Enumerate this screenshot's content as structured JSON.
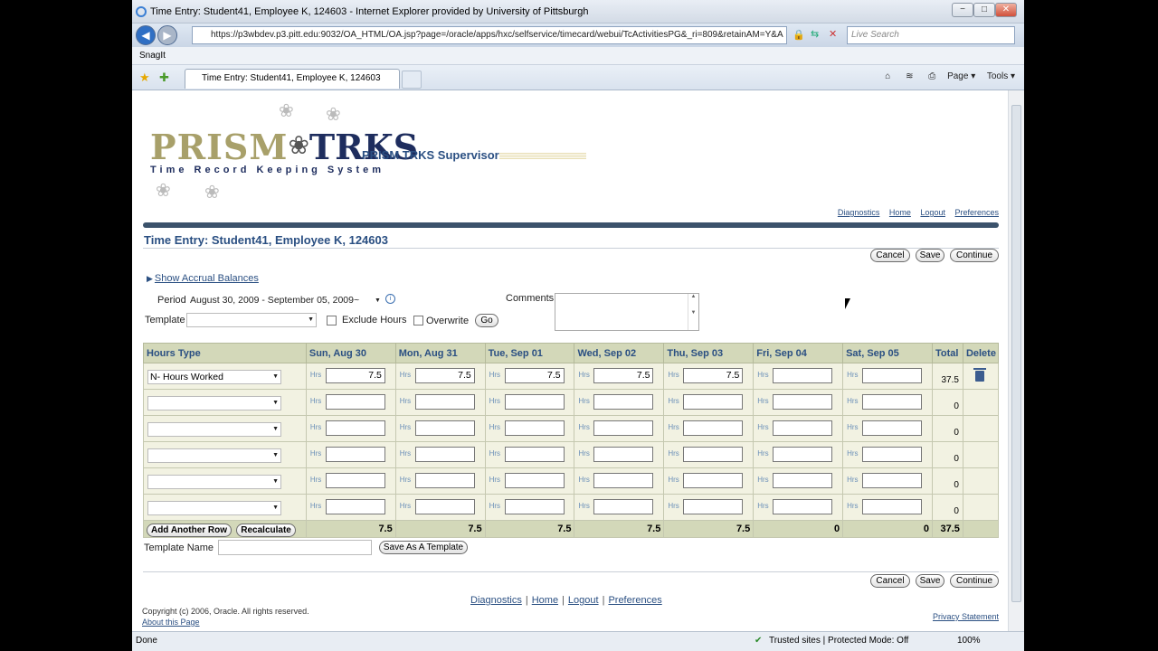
{
  "window": {
    "title": "Time Entry: Student41, Employee K, 124603 - Internet Explorer provided by University of Pittsburgh",
    "minimize": "−",
    "maximize": "□",
    "close": "✕"
  },
  "browser": {
    "url": "https://p3wbdev.p3.pitt.edu:9032/OA_HTML/OA.jsp?page=/oracle/apps/hxc/selfservice/timecard/webui/TcActivitiesPG&_ri=809&retainAM=Y&A",
    "search_placeholder": "Live Search",
    "snagit": "SnagIt",
    "tab_title": "Time Entry: Student41, Employee K, 124603",
    "page_menu": "Page ▾",
    "tools_menu": "Tools ▾",
    "status": "Done",
    "zone": "Trusted sites | Protected Mode: Off",
    "zoom": "100%"
  },
  "header": {
    "logo_left": "PRISM",
    "logo_right": "TRKS",
    "tagline": "Time Record Keeping System",
    "app_title": "PRISM TRKS Supervisor"
  },
  "global_links": [
    "Diagnostics",
    "Home",
    "Logout",
    "Preferences"
  ],
  "page": {
    "title": "Time Entry: Student41, Employee K, 124603",
    "cancel": "Cancel",
    "save": "Save",
    "continue": "Continue",
    "show_accrual": "Show Accrual Balances",
    "period_label": "Period",
    "period_value": "August 30, 2009 - September 05, 2009~",
    "template_label": "Template",
    "template_value": "",
    "exclude_hours": "Exclude Hours",
    "overwrite": "Overwrite",
    "go": "Go",
    "comments_label": "Comments"
  },
  "grid": {
    "headers": [
      "Hours Type",
      "Sun, Aug 30",
      "Mon, Aug 31",
      "Tue, Sep 01",
      "Wed, Sep 02",
      "Thu, Sep 03",
      "Fri, Sep 04",
      "Sat, Sep 05",
      "Total",
      "Delete"
    ],
    "hrs_label": "Hrs",
    "rows": [
      {
        "type": "N- Hours Worked",
        "values": [
          "7.5",
          "7.5",
          "7.5",
          "7.5",
          "7.5",
          "",
          ""
        ],
        "total": "37.5"
      },
      {
        "type": "",
        "values": [
          "",
          "",
          "",
          "",
          "",
          "",
          ""
        ],
        "total": "0"
      },
      {
        "type": "",
        "values": [
          "",
          "",
          "",
          "",
          "",
          "",
          ""
        ],
        "total": "0"
      },
      {
        "type": "",
        "values": [
          "",
          "",
          "",
          "",
          "",
          "",
          ""
        ],
        "total": "0"
      },
      {
        "type": "",
        "values": [
          "",
          "",
          "",
          "",
          "",
          "",
          ""
        ],
        "total": "0"
      },
      {
        "type": "",
        "values": [
          "",
          "",
          "",
          "",
          "",
          "",
          ""
        ],
        "total": "0"
      }
    ],
    "add_row": "Add Another Row",
    "recalculate": "Recalculate",
    "day_totals": [
      "7.5",
      "7.5",
      "7.5",
      "7.5",
      "7.5",
      "0",
      "0"
    ],
    "grand_total": "37.5"
  },
  "template_name_label": "Template Name",
  "save_as_template": "Save As A Template",
  "footer": {
    "copyright": "Copyright (c) 2006, Oracle. All rights reserved.",
    "about": "About this Page",
    "privacy": "Privacy Statement"
  }
}
